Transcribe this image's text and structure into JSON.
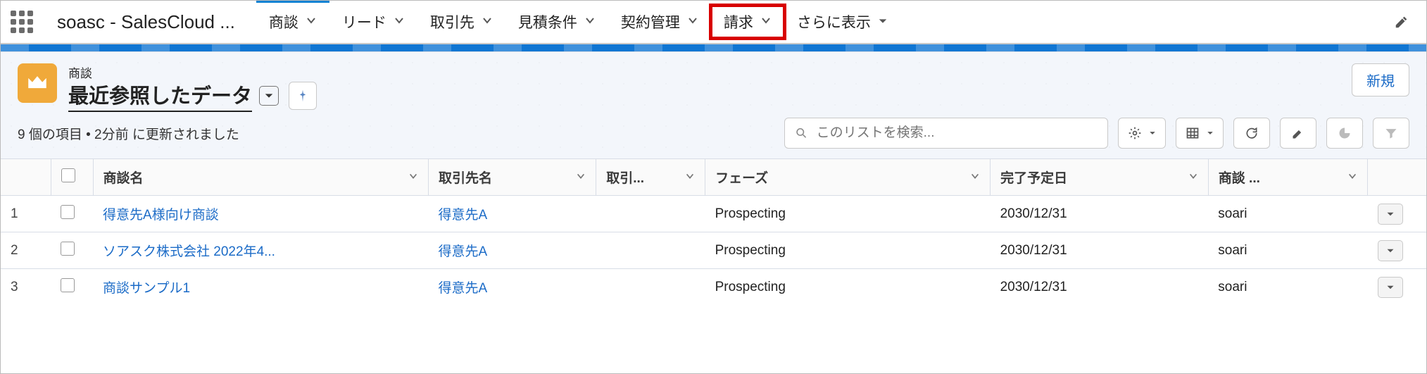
{
  "header": {
    "app_name": "soasc - SalesCloud ..."
  },
  "nav": {
    "items": [
      {
        "label": "商談",
        "active": true,
        "highlight": false
      },
      {
        "label": "リード",
        "active": false,
        "highlight": false
      },
      {
        "label": "取引先",
        "active": false,
        "highlight": false
      },
      {
        "label": "見積条件",
        "active": false,
        "highlight": false
      },
      {
        "label": "契約管理",
        "active": false,
        "highlight": false
      },
      {
        "label": "請求",
        "active": false,
        "highlight": true
      },
      {
        "label": "さらに表示",
        "active": false,
        "highlight": false
      }
    ]
  },
  "page": {
    "object_label": "商談",
    "list_view_name": "最近参照したデータ",
    "new_button_label": "新規",
    "meta_text": "9 個の項目 • 2分前 に更新されました",
    "search_placeholder": "このリストを検索..."
  },
  "columns": {
    "c1": "商談名",
    "c2": "取引先名",
    "c3": "取引...",
    "c4": "フェーズ",
    "c5": "完了予定日",
    "c6": "商談 ..."
  },
  "rows": [
    {
      "num": "1",
      "name": "得意先A様向け商談",
      "account": "得意先A",
      "phase": "Prospecting",
      "date": "2030/12/31",
      "owner": "soari"
    },
    {
      "num": "2",
      "name": "ソアスク株式会社 2022年4...",
      "account": "得意先A",
      "phase": "Prospecting",
      "date": "2030/12/31",
      "owner": "soari"
    },
    {
      "num": "3",
      "name": "商談サンプル1",
      "account": "得意先A",
      "phase": "Prospecting",
      "date": "2030/12/31",
      "owner": "soari"
    }
  ],
  "icons": {
    "app_launcher": "app-launcher-icon",
    "pencil": "pencil-icon",
    "crown": "crown-icon",
    "pin": "pin-icon",
    "gear": "gear-icon",
    "table": "table-icon",
    "refresh": "refresh-icon",
    "chart": "chart-icon",
    "filter": "filter-icon",
    "search": "search-icon",
    "chevron_down": "chevron-down-icon"
  }
}
